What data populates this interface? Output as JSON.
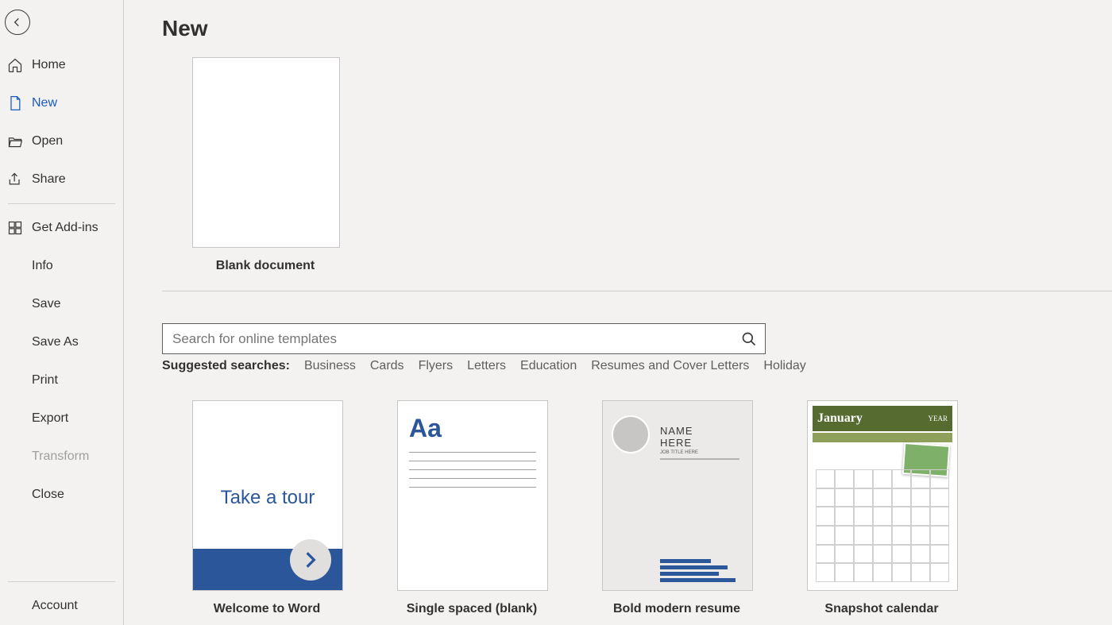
{
  "page_title": "New",
  "sidebar": {
    "items": [
      {
        "label": "Home"
      },
      {
        "label": "New"
      },
      {
        "label": "Open"
      },
      {
        "label": "Share"
      },
      {
        "label": "Get Add-ins"
      },
      {
        "label": "Info"
      },
      {
        "label": "Save"
      },
      {
        "label": "Save As"
      },
      {
        "label": "Print"
      },
      {
        "label": "Export"
      },
      {
        "label": "Transform"
      },
      {
        "label": "Close"
      },
      {
        "label": "Account"
      }
    ]
  },
  "blank": {
    "label": "Blank document"
  },
  "search": {
    "placeholder": "Search for online templates"
  },
  "suggested_label": "Suggested searches:",
  "suggested": [
    "Business",
    "Cards",
    "Flyers",
    "Letters",
    "Education",
    "Resumes and Cover Letters",
    "Holiday"
  ],
  "templates": [
    {
      "label": "Welcome to Word",
      "tour_text": "Take a tour"
    },
    {
      "label": "Single spaced (blank)",
      "aa": "Aa"
    },
    {
      "label": "Bold modern resume",
      "name1": "NAME",
      "name2": "HERE",
      "sub": "JOB TITLE HERE"
    },
    {
      "label": "Snapshot calendar",
      "month": "January",
      "year": "YEAR"
    }
  ]
}
